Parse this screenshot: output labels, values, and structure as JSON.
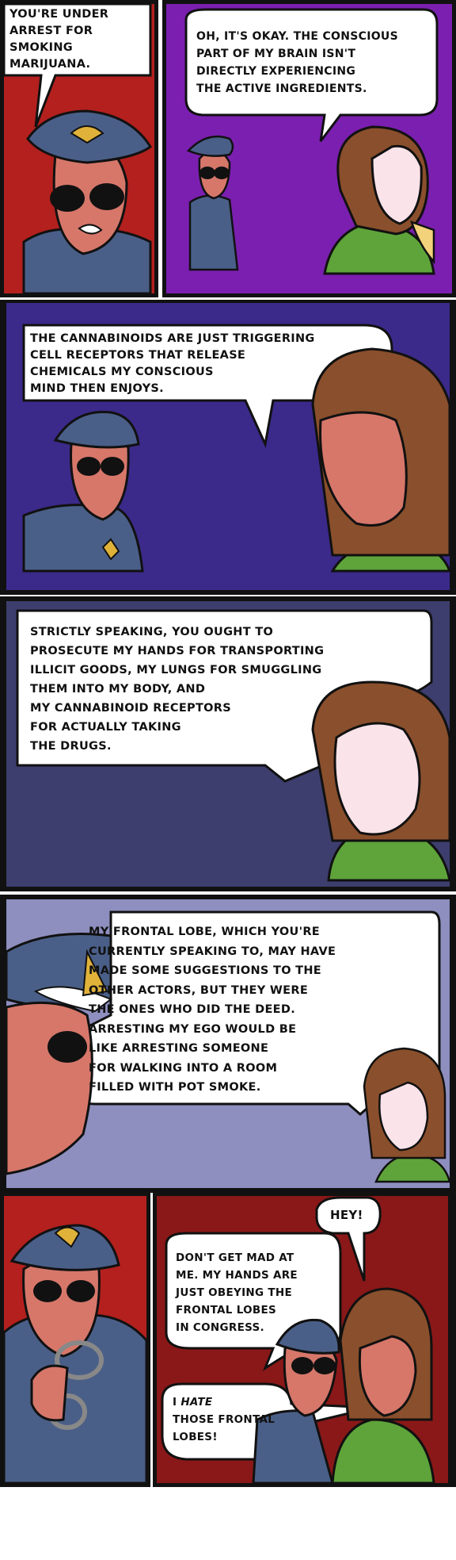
{
  "panels": [
    {
      "id": "p1",
      "bubbles": [
        {
          "text": "You're under\narrest for\nsmoking\nmarijuana."
        }
      ]
    },
    {
      "id": "p2",
      "bubbles": [
        {
          "text": "Oh, it's okay. The conscious\npart of my brain isn't\ndirectly experiencing\nthe active ingredients."
        }
      ]
    },
    {
      "id": "p3",
      "bubbles": [
        {
          "text": "The cannabinoids are just triggering\ncell receptors that release\nchemicals my conscious\nmind then enjoys."
        }
      ]
    },
    {
      "id": "p4",
      "bubbles": [
        {
          "text": "Strictly speaking, you ought to\nprosecute my hands for transporting\nillicit goods, my lungs for smuggling\nthem into my body, and\nmy cannabinoid receptors\nfor actually taking\nthe drugs."
        }
      ]
    },
    {
      "id": "p5",
      "bubbles": [
        {
          "text": "My frontal lobe, which you're\ncurrently speaking to, may have\nmade some suggestions to the\nother actors, but they were\nthe ones who did the deed.\nArresting my ego would be\nlike arresting someone\nfor walking into a room\nfilled with pot smoke."
        }
      ]
    },
    {
      "id": "p6",
      "bubbles": [
        {
          "text": "Hey!"
        },
        {
          "text": "Don't get mad at\nme. My hands are\njust obeying the\nfrontal lobes\nin Congress."
        },
        {
          "text_prefix": "I",
          "text_emph": "hate",
          "text_suffix": "\nthose frontal\nlobes!"
        }
      ]
    }
  ],
  "colors": {
    "red": "#b3201e",
    "purple": "#7b1fb0",
    "indigo": "#3b2a8a",
    "slate": "#3d3e6e",
    "lavender": "#8e8fbf",
    "uniform": "#4a5f88",
    "skin": "#d6776a",
    "hair": "#8a4f2c",
    "shirt": "#5ea43a",
    "badge": "#e0b23a"
  }
}
